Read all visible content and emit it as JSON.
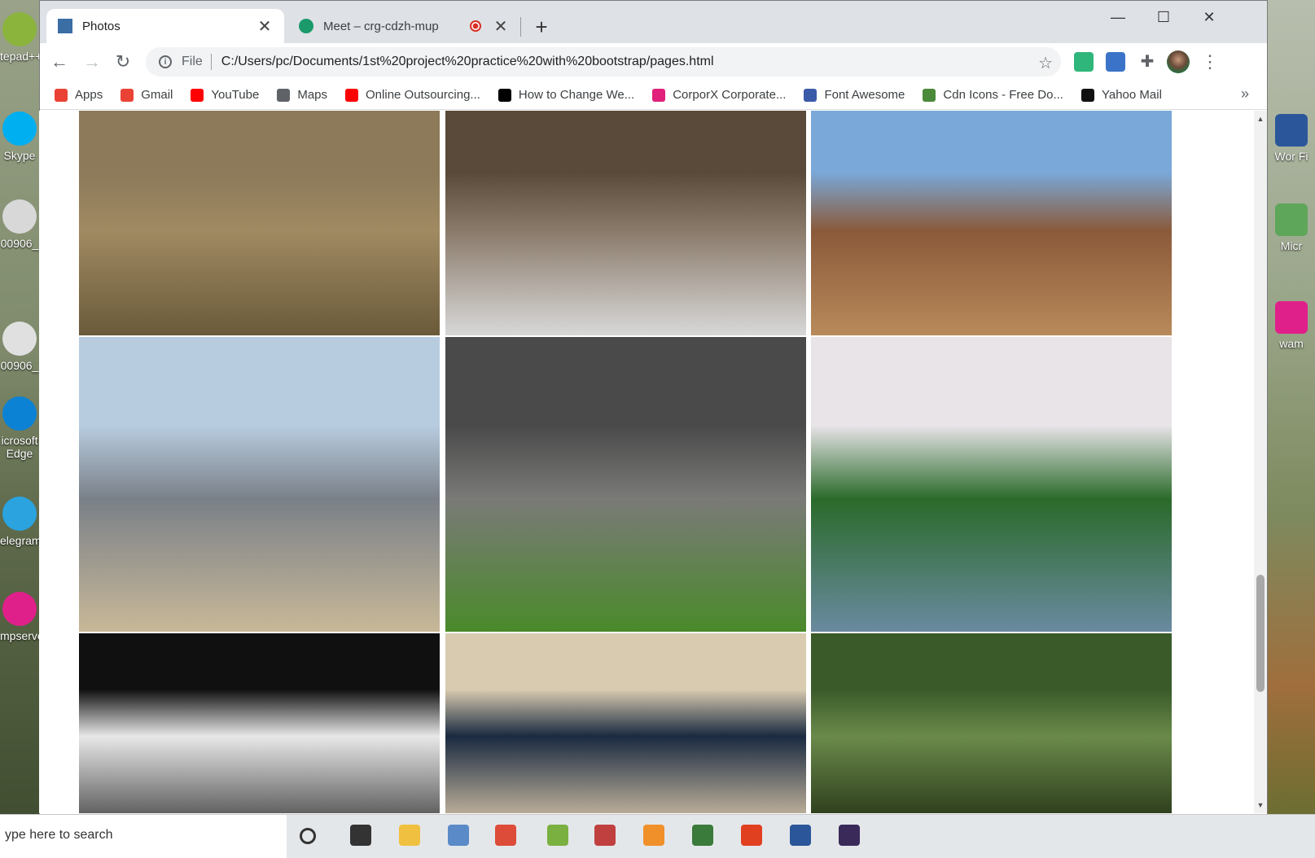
{
  "desktop": {
    "left_icons": [
      {
        "label": "tepad++",
        "color": "#8ab43c"
      },
      {
        "label": "Skype",
        "color": "#00aff0"
      },
      {
        "label": "00906_",
        "color": "#d8d8d8"
      },
      {
        "label": "00906_",
        "color": "#e0e0e0"
      },
      {
        "label": "icrosoft Edge",
        "color": "#0c82d4"
      },
      {
        "label": "elegram",
        "color": "#2aa3df"
      },
      {
        "label": "mpserve",
        "color": "#e0208a"
      }
    ],
    "right_icons": [
      {
        "label": "Wor Fi",
        "color": "#2b579a"
      },
      {
        "label": "Micr",
        "color": "#5ea65a"
      },
      {
        "label": "wam",
        "color": "#e0208a"
      }
    ]
  },
  "browser": {
    "tabs": [
      {
        "title": "Photos",
        "active": true,
        "favicon_color": "#3a6ea5"
      },
      {
        "title": "Meet – crg-cdzh-mup",
        "active": false,
        "favicon_color": "#1a9a6a",
        "recording": true
      }
    ],
    "window_controls": {
      "minimize": "—",
      "maximize": "☐",
      "close": "✕"
    },
    "nav": {
      "back": "←",
      "forward": "→",
      "reload": "↻"
    },
    "address": {
      "scheme_label": "File",
      "url": "C:/Users/pc/Documents/1st%20project%20practice%20with%20bootstrap/pages.html",
      "bookmark_star": "☆"
    },
    "extensions": [
      {
        "name": "extension-green-icon",
        "color": "#2fb67a"
      },
      {
        "name": "extension-github-icon",
        "color": "#3b73c8"
      },
      {
        "name": "extensions-puzzle-icon",
        "color": "#5f6368"
      }
    ],
    "bookmarks": [
      {
        "label": "Apps",
        "icon": "apps-grid-icon",
        "color": "#e94235"
      },
      {
        "label": "Gmail",
        "icon": "gmail-icon",
        "color": "#ea4335"
      },
      {
        "label": "YouTube",
        "icon": "youtube-icon",
        "color": "#ff0000"
      },
      {
        "label": "Maps",
        "icon": "globe-icon",
        "color": "#5f6368"
      },
      {
        "label": "Online Outsourcing...",
        "icon": "youtube-icon",
        "color": "#ff0000"
      },
      {
        "label": "How to Change We...",
        "icon": "dt-icon",
        "color": "#000000"
      },
      {
        "label": "CorporX Corporate...",
        "icon": "corporx-icon",
        "color": "#e0207a"
      },
      {
        "label": "Font Awesome",
        "icon": "font-awesome-icon",
        "color": "#3b5aa8"
      },
      {
        "label": "Cdn Icons - Free Do...",
        "icon": "cdn-icons-icon",
        "color": "#4a8a3a"
      },
      {
        "label": "Yahoo Mail",
        "icon": "amazon-icon",
        "color": "#111111"
      }
    ],
    "bookmarks_more": "»"
  },
  "gallery": {
    "photos": [
      {
        "subject": "parade",
        "colors": [
          "#8c7a5a",
          "#a08a62",
          "#6a5a3a"
        ]
      },
      {
        "subject": "relief-distribution",
        "colors": [
          "#5a4a3a",
          "#8a7a6a",
          "#d8d8d8"
        ]
      },
      {
        "subject": "old-brick-ruins",
        "colors": [
          "#7aa8d8",
          "#8a5a3a",
          "#b88a5a"
        ]
      },
      {
        "subject": "steel-bridge-river",
        "colors": [
          "#b8cce0",
          "#7a8088",
          "#c8b898"
        ]
      },
      {
        "subject": "burning-bus-road",
        "colors": [
          "#4a4a4a",
          "#7a7a78",
          "#4a8a2a"
        ]
      },
      {
        "subject": "river-green-bank",
        "colors": [
          "#e8e4e8",
          "#2a6a2a",
          "#6a8aa0"
        ]
      },
      {
        "subject": "railway-station-bw",
        "colors": [
          "#101010",
          "#e8e8e8",
          "#555555"
        ]
      },
      {
        "subject": "police-group",
        "colors": [
          "#d8cbb0",
          "#1a2a40",
          "#c8b8a0"
        ]
      },
      {
        "subject": "forest-trees",
        "colors": [
          "#3a5a2a",
          "#6a8a4a",
          "#2a3a1a"
        ]
      }
    ]
  },
  "taskbar": {
    "search_placeholder": "ype here to search",
    "apps": [
      {
        "name": "search-icon",
        "color": "#333333"
      },
      {
        "name": "task-view-icon",
        "color": "#333333"
      },
      {
        "name": "file-explorer-icon",
        "color": "#f0c040"
      },
      {
        "name": "store-icon",
        "color": "#5a8ac8"
      },
      {
        "name": "chrome-icon",
        "color": "#dd4b39"
      },
      {
        "name": "notepad-icon",
        "color": "#7ab040"
      },
      {
        "name": "paint-icon",
        "color": "#c04040"
      },
      {
        "name": "sublime-icon",
        "color": "#f0902a"
      },
      {
        "name": "snip-icon",
        "color": "#3a7a3a"
      },
      {
        "name": "office-icon",
        "color": "#e04020"
      },
      {
        "name": "word-icon",
        "color": "#2b579a"
      },
      {
        "name": "app-icon",
        "color": "#3a2a5a"
      }
    ]
  }
}
